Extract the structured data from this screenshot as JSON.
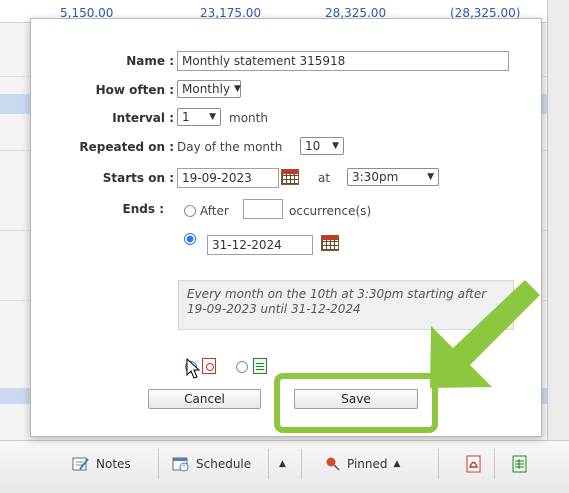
{
  "background": {
    "numbers": [
      "5,150.00",
      "23,175.00",
      "28,325.00",
      "(28,325.00)"
    ]
  },
  "dialog": {
    "name": {
      "label": "Name :",
      "value": "Monthly statement 315918"
    },
    "how_often": {
      "label": "How often :",
      "value": "Monthly"
    },
    "interval": {
      "label": "Interval :",
      "value": "1",
      "unit": "month"
    },
    "repeated_on": {
      "label": "Repeated on :",
      "prefix": "Day of the month",
      "value": "10"
    },
    "starts_on": {
      "label": "Starts on :",
      "date": "19-09-2023",
      "at": "at",
      "time": "3:30pm"
    },
    "ends": {
      "label": "Ends :",
      "after_label": "After",
      "after_value": "",
      "occurrence_label": "occurrence(s)",
      "end_date": "31-12-2024",
      "after_selected": false,
      "date_selected": true
    },
    "summary": "Every month on the 10th at 3:30pm starting after 19-09-2023 until 31-12-2024",
    "format": {
      "pdf_selected": true,
      "excel_selected": false
    },
    "cancel_label": "Cancel",
    "save_label": "Save"
  },
  "toolbar": {
    "notes": "Notes",
    "schedule": "Schedule",
    "pinned": "Pinned",
    "caret": "▲"
  },
  "colors": {
    "highlight": "#8dc63f",
    "radio_selected": "#2d7be5",
    "link_blue": "#2a5db0"
  }
}
